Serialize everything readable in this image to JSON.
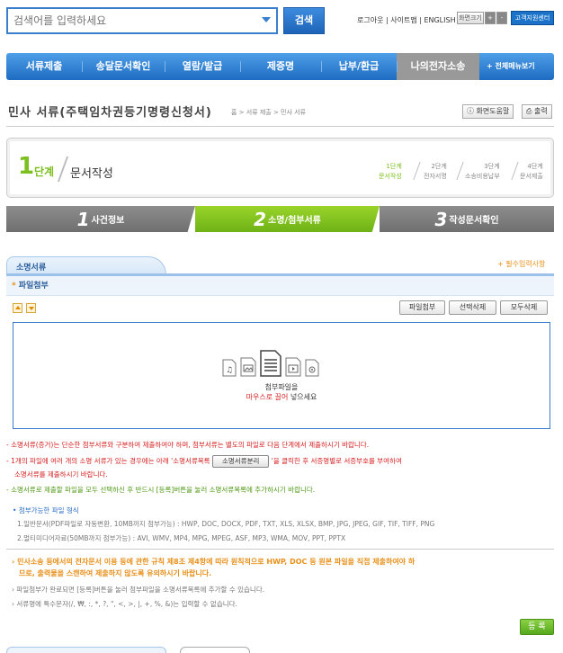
{
  "header": {
    "search_placeholder": "검색어를 입력하세요",
    "search_button": "검색",
    "util_links": "로그아웃 | 사이트맵 | ENGLISH",
    "font_label": "화면크기",
    "font_plus": "+",
    "font_minus": "-",
    "support_button": "고객지원센터"
  },
  "nav": {
    "items": [
      {
        "label": "서류제출"
      },
      {
        "label": "송달문서확인"
      },
      {
        "label": "열람/발급"
      },
      {
        "label": "제증명"
      },
      {
        "label": "납부/환급"
      },
      {
        "label": "나의전자소송"
      }
    ],
    "all_menu": "+ 전체메뉴보기"
  },
  "page": {
    "title": "민사 서류(주택임차권등기명령신청서)",
    "breadcrumb": "홈 > 서류 제출 > 민사 서류",
    "help_button": "화면도움말",
    "print_button": "출력"
  },
  "step": {
    "number": "1",
    "unit": "단계",
    "name": "문서작성",
    "mini": [
      {
        "line1": "1단계",
        "line2": "문서작성"
      },
      {
        "line1": "2단계",
        "line2": "전자서명"
      },
      {
        "line1": "3단계",
        "line2": "소송비용납부"
      },
      {
        "line1": "4단계",
        "line2": "문서제출"
      }
    ]
  },
  "tabs": [
    {
      "num": "1",
      "label": "사건정보"
    },
    {
      "num": "2",
      "label": "소명/첨부서류"
    },
    {
      "num": "3",
      "label": "작성문서확인"
    }
  ],
  "section": {
    "tab_label": "소명서류",
    "required_note": "+ 필수입력사항",
    "attach_title": "파일첨부",
    "attach_star": "*",
    "buttons": {
      "attach": "파일첨부",
      "delete_selected": "선택삭제",
      "delete_all": "모두삭제"
    },
    "drop_line1": "첨부파일을",
    "drop_line2_red": "마우스로 끌어",
    "drop_line2_rest": " 넣으세요"
  },
  "notes": {
    "n1": "- 소명서류(증거)는 단순한 첨부서류와 구분하여 제출하여야 하며, 첨부서류는 별도의 파일로 다음 단계에서 제출하시기 바랍니다.",
    "n2_pre": "- 1개의 파일에 여러 개의 소명 서류가 있는 경우에는 아래 '소명서류목록",
    "n2_button": "소명서류분리",
    "n2_post": "'을 클릭한 후 서증명별로 서증부호를 부여하여",
    "n2_line2": "소명서류를 제출하시기 바랍니다.",
    "n3": "- 소명서류로 제출할 파일을 모두 선택하신 후 반드시 [등록]버튼을 눌러 소명서류목록에 추가하시기 바랍니다.",
    "formats_title": "첨부가능한 파일 형식",
    "formats_1": "1.일반문서(PDF파일로 자동변환, 10MB까지 첨부가능) : HWP, DOC, DOCX, PDF, TXT, XLS, XLSX, BMP, JPG, JPEG, GIF, TIF, TIFF, PNG",
    "formats_2": "2.멀티미디어자료(50MB까지 첨부가능) : AVI, WMV, MP4, MPG, MPEG, ASF, MP3, WMA, MOV, PPT, PPTX",
    "warn_1": "민사소송 등에서의 전자문서 이용 등에 관한 규칙 제8조 제4항에 따라 원칙적으로 HWP, DOC 등 원본 파일을 직접 제출하여야 하",
    "warn_2": "므로, 출력물을 스캔하여 제출하지 않도록 유의하시기 바랍니다.",
    "info_1": "파일첨부가 완료되면 [등록]버튼을 눌러 첨부파일을 소명서류목록에 추가할 수 있습니다.",
    "info_2": "서류명에 특수문자(/, ₩, :, *, ?, \", <, >, |, +, %, &)는 입력할 수 없습니다."
  },
  "register_button": "등 록",
  "colors": {
    "primary": "#1e6cc2",
    "accent_green": "#7cbf1e",
    "warning_red": "#d62020",
    "orange": "#e8901a"
  }
}
